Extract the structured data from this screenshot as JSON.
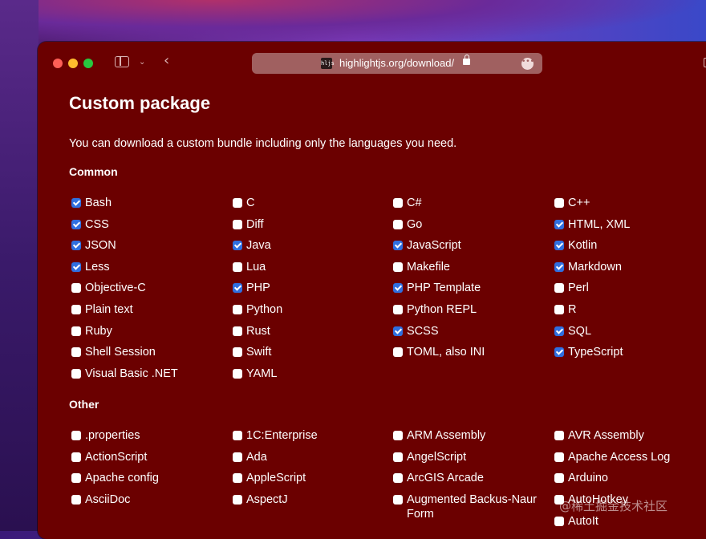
{
  "browser": {
    "url": "highlightjs.org/download/",
    "favicon_text": "hljs"
  },
  "page": {
    "title": "Custom package",
    "description": "You can download a custom bundle including only the languages you need.",
    "sections": [
      {
        "title": "Common",
        "languages": [
          {
            "label": "Bash",
            "checked": true
          },
          {
            "label": "C",
            "checked": false
          },
          {
            "label": "C#",
            "checked": false
          },
          {
            "label": "C++",
            "checked": false
          },
          {
            "label": "CSS",
            "checked": true
          },
          {
            "label": "Diff",
            "checked": false
          },
          {
            "label": "Go",
            "checked": false
          },
          {
            "label": "HTML, XML",
            "checked": true
          },
          {
            "label": "JSON",
            "checked": true
          },
          {
            "label": "Java",
            "checked": true
          },
          {
            "label": "JavaScript",
            "checked": true
          },
          {
            "label": "Kotlin",
            "checked": true
          },
          {
            "label": "Less",
            "checked": true
          },
          {
            "label": "Lua",
            "checked": false
          },
          {
            "label": "Makefile",
            "checked": false
          },
          {
            "label": "Markdown",
            "checked": true
          },
          {
            "label": "Objective-C",
            "checked": false
          },
          {
            "label": "PHP",
            "checked": true
          },
          {
            "label": "PHP Template",
            "checked": true
          },
          {
            "label": "Perl",
            "checked": false
          },
          {
            "label": "Plain text",
            "checked": false
          },
          {
            "label": "Python",
            "checked": false
          },
          {
            "label": "Python REPL",
            "checked": false
          },
          {
            "label": "R",
            "checked": false
          },
          {
            "label": "Ruby",
            "checked": false
          },
          {
            "label": "Rust",
            "checked": false
          },
          {
            "label": "SCSS",
            "checked": true
          },
          {
            "label": "SQL",
            "checked": true
          },
          {
            "label": "Shell Session",
            "checked": false
          },
          {
            "label": "Swift",
            "checked": false
          },
          {
            "label": "TOML, also INI",
            "checked": false
          },
          {
            "label": "TypeScript",
            "checked": true
          },
          {
            "label": "Visual Basic .NET",
            "checked": false
          },
          {
            "label": "YAML",
            "checked": false
          }
        ]
      },
      {
        "title": "Other",
        "languages": [
          {
            "label": ".properties",
            "checked": false
          },
          {
            "label": "1C:Enterprise",
            "checked": false
          },
          {
            "label": "ARM Assembly",
            "checked": false
          },
          {
            "label": "AVR Assembly",
            "checked": false
          },
          {
            "label": "ActionScript",
            "checked": false
          },
          {
            "label": "Ada",
            "checked": false
          },
          {
            "label": "AngelScript",
            "checked": false
          },
          {
            "label": "Apache Access Log",
            "checked": false
          },
          {
            "label": "Apache config",
            "checked": false
          },
          {
            "label": "AppleScript",
            "checked": false
          },
          {
            "label": "ArcGIS Arcade",
            "checked": false
          },
          {
            "label": "Arduino",
            "checked": false
          },
          {
            "label": "AsciiDoc",
            "checked": false
          },
          {
            "label": "AspectJ",
            "checked": false
          },
          {
            "label": "Augmented Backus-Naur Form",
            "checked": false
          },
          {
            "label": "AutoHotkey",
            "checked": false
          },
          {
            "label": "AutoIt",
            "checked": false
          }
        ]
      }
    ]
  },
  "watermark": "@稀土掘金技术社区",
  "colors": {
    "page_background": "#6b0000",
    "checkbox_checked": "#2f6fe0",
    "url_bar": "#a06060"
  }
}
